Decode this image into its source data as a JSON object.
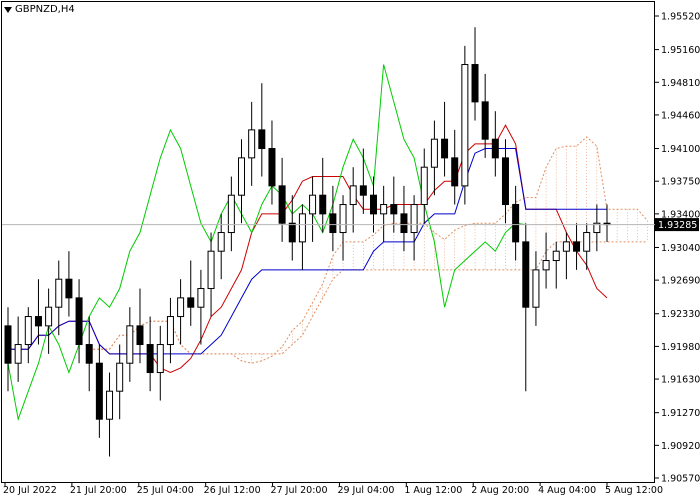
{
  "symbol_label": "GBPNZD,H4",
  "current_price_label": "1.93285",
  "colors": {
    "background": "#ffffff",
    "candle": "#000000",
    "tenkan": "#cc0000",
    "kijun": "#0000cc",
    "chikou": "#00cc00",
    "senkou": "#e09060",
    "bid_line": "#b4b4b4",
    "price_tag_bg": "#000000",
    "price_tag_text": "#ffffff"
  },
  "chart_data": {
    "type": "candlestick",
    "title": "GBPNZD,H4",
    "ylim": [
      1.9057,
      1.9552
    ],
    "y_ticks": [
      "1.95520",
      "1.95160",
      "1.94810",
      "1.94460",
      "1.94100",
      "1.93750",
      "1.93400",
      "1.93040",
      "1.92690",
      "1.92330",
      "1.91980",
      "1.91630",
      "1.91270",
      "1.90920",
      "1.90570"
    ],
    "x_ticks": [
      "20 Jul 2022",
      "21 Jul 20:00",
      "25 Jul 04:00",
      "26 Jul 12:00",
      "27 Jul 20:00",
      "29 Jul 04:00",
      "1 Aug 12:00",
      "2 Aug 20:00",
      "4 Aug 04:00",
      "5 Aug 12:00"
    ],
    "current_price": 1.93285,
    "indicators": [
      "Ichimoku Kinko Hyo"
    ],
    "candles": [
      [
        1.922,
        1.924,
        1.915,
        1.918
      ],
      [
        1.918,
        1.923,
        1.916,
        1.92
      ],
      [
        1.92,
        1.924,
        1.918,
        1.923
      ],
      [
        1.923,
        1.927,
        1.92,
        1.922
      ],
      [
        1.922,
        1.926,
        1.919,
        1.924
      ],
      [
        1.924,
        1.929,
        1.921,
        1.927
      ],
      [
        1.927,
        1.93,
        1.923,
        1.925
      ],
      [
        1.925,
        1.927,
        1.918,
        1.92
      ],
      [
        1.92,
        1.923,
        1.915,
        1.918
      ],
      [
        1.918,
        1.92,
        1.91,
        1.912
      ],
      [
        1.912,
        1.917,
        1.908,
        1.915
      ],
      [
        1.915,
        1.92,
        1.912,
        1.918
      ],
      [
        1.918,
        1.924,
        1.916,
        1.922
      ],
      [
        1.922,
        1.926,
        1.918,
        1.92
      ],
      [
        1.92,
        1.923,
        1.915,
        1.917
      ],
      [
        1.917,
        1.922,
        1.914,
        1.92
      ],
      [
        1.92,
        1.925,
        1.918,
        1.923
      ],
      [
        1.923,
        1.927,
        1.92,
        1.925
      ],
      [
        1.925,
        1.929,
        1.922,
        1.924
      ],
      [
        1.924,
        1.928,
        1.92,
        1.926
      ],
      [
        1.926,
        1.932,
        1.923,
        1.93
      ],
      [
        1.93,
        1.934,
        1.927,
        1.932
      ],
      [
        1.932,
        1.938,
        1.93,
        1.936
      ],
      [
        1.936,
        1.942,
        1.933,
        1.94
      ],
      [
        1.94,
        1.946,
        1.937,
        1.943
      ],
      [
        1.943,
        1.948,
        1.938,
        1.941
      ],
      [
        1.941,
        1.944,
        1.935,
        1.937
      ],
      [
        1.937,
        1.94,
        1.931,
        1.933
      ],
      [
        1.933,
        1.936,
        1.929,
        1.931
      ],
      [
        1.931,
        1.935,
        1.928,
        1.934
      ],
      [
        1.934,
        1.938,
        1.931,
        1.936
      ],
      [
        1.936,
        1.94,
        1.932,
        1.934
      ],
      [
        1.934,
        1.937,
        1.93,
        1.932
      ],
      [
        1.932,
        1.936,
        1.929,
        1.935
      ],
      [
        1.935,
        1.939,
        1.932,
        1.937
      ],
      [
        1.937,
        1.941,
        1.934,
        1.936
      ],
      [
        1.936,
        1.938,
        1.932,
        1.934
      ],
      [
        1.934,
        1.937,
        1.931,
        1.935
      ],
      [
        1.935,
        1.938,
        1.932,
        1.934
      ],
      [
        1.934,
        1.937,
        1.93,
        1.932
      ],
      [
        1.932,
        1.936,
        1.929,
        1.935
      ],
      [
        1.935,
        1.941,
        1.933,
        1.939
      ],
      [
        1.939,
        1.944,
        1.936,
        1.942
      ],
      [
        1.942,
        1.946,
        1.938,
        1.94
      ],
      [
        1.94,
        1.943,
        1.935,
        1.937
      ],
      [
        1.937,
        1.952,
        1.935,
        1.95
      ],
      [
        1.95,
        1.954,
        1.944,
        1.946
      ],
      [
        1.946,
        1.949,
        1.94,
        1.942
      ],
      [
        1.942,
        1.945,
        1.938,
        1.94
      ],
      [
        1.94,
        1.942,
        1.933,
        1.935
      ],
      [
        1.935,
        1.937,
        1.929,
        1.931
      ],
      [
        1.931,
        1.933,
        1.915,
        1.924
      ],
      [
        1.924,
        1.93,
        1.922,
        1.928
      ],
      [
        1.928,
        1.932,
        1.926,
        1.929
      ],
      [
        1.929,
        1.931,
        1.926,
        1.93
      ],
      [
        1.93,
        1.932,
        1.927,
        1.931
      ],
      [
        1.931,
        1.933,
        1.928,
        1.93
      ],
      [
        1.93,
        1.933,
        1.928,
        1.932
      ],
      [
        1.932,
        1.935,
        1.93,
        1.933
      ],
      [
        1.933,
        1.935,
        1.931,
        1.93285
      ]
    ]
  }
}
